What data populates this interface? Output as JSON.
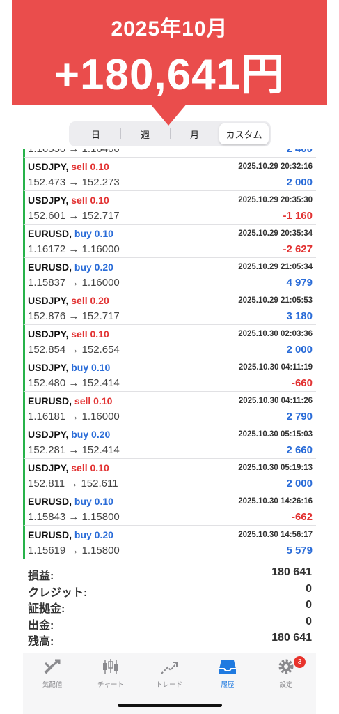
{
  "banner": {
    "month": "2025年10月",
    "amount": "+180,641円"
  },
  "segments": [
    "日",
    "週",
    "月",
    "カスタム"
  ],
  "selected_segment": "カスタム",
  "partial_row": {
    "prices": "1.16550 → 1.16400",
    "profit": "2 400"
  },
  "trades": [
    {
      "symbol": "USDJPY,",
      "direction": "sell",
      "volume": "sell 0.10",
      "time": "2025.10.29 20:32:16",
      "prices": "152.473 → 152.273",
      "profit": "2 000"
    },
    {
      "symbol": "USDJPY,",
      "direction": "sell",
      "volume": "sell 0.10",
      "time": "2025.10.29 20:35:30",
      "prices": "152.601 → 152.717",
      "profit": "-1 160"
    },
    {
      "symbol": "EURUSD,",
      "direction": "buy",
      "volume": "buy 0.10",
      "time": "2025.10.29 20:35:34",
      "prices": "1.16172 → 1.16000",
      "profit": "-2 627"
    },
    {
      "symbol": "EURUSD,",
      "direction": "buy",
      "volume": "buy 0.20",
      "time": "2025.10.29 21:05:34",
      "prices": "1.15837 → 1.16000",
      "profit": "4 979"
    },
    {
      "symbol": "USDJPY,",
      "direction": "sell",
      "volume": "sell 0.20",
      "time": "2025.10.29 21:05:53",
      "prices": "152.876 → 152.717",
      "profit": "3 180"
    },
    {
      "symbol": "USDJPY,",
      "direction": "sell",
      "volume": "sell 0.10",
      "time": "2025.10.30 02:03:36",
      "prices": "152.854 → 152.654",
      "profit": "2 000"
    },
    {
      "symbol": "USDJPY,",
      "direction": "buy",
      "volume": "buy 0.10",
      "time": "2025.10.30 04:11:19",
      "prices": "152.480 → 152.414",
      "profit": "-660"
    },
    {
      "symbol": "EURUSD,",
      "direction": "sell",
      "volume": "sell 0.10",
      "time": "2025.10.30 04:11:26",
      "prices": "1.16181 → 1.16000",
      "profit": "2 790"
    },
    {
      "symbol": "USDJPY,",
      "direction": "buy",
      "volume": "buy 0.20",
      "time": "2025.10.30 05:15:03",
      "prices": "152.281 → 152.414",
      "profit": "2 660"
    },
    {
      "symbol": "USDJPY,",
      "direction": "sell",
      "volume": "sell 0.10",
      "time": "2025.10.30 05:19:13",
      "prices": "152.811 → 152.611",
      "profit": "2 000"
    },
    {
      "symbol": "EURUSD,",
      "direction": "buy",
      "volume": "buy 0.10",
      "time": "2025.10.30 14:26:16",
      "prices": "1.15843 → 1.15800",
      "profit": "-662"
    },
    {
      "symbol": "EURUSD,",
      "direction": "buy",
      "volume": "buy 0.20",
      "time": "2025.10.30 14:56:17",
      "prices": "1.15619 → 1.15800",
      "profit": "5 579"
    }
  ],
  "summary": [
    {
      "label": "損益:",
      "value": "180 641"
    },
    {
      "label": "クレジット:",
      "value": "0"
    },
    {
      "label": "証拠金:",
      "value": "0"
    },
    {
      "label": "出金:",
      "value": "0"
    },
    {
      "label": "残高:",
      "value": "180 641"
    }
  ],
  "tabbar": {
    "items": [
      {
        "label": "気配値",
        "icon": "quotes-icon"
      },
      {
        "label": "チャート",
        "icon": "chart-icon"
      },
      {
        "label": "トレード",
        "icon": "trade-icon"
      },
      {
        "label": "履歴",
        "icon": "history-icon"
      },
      {
        "label": "設定",
        "icon": "settings-icon",
        "badge": "3"
      }
    ],
    "active": "履歴"
  },
  "colors": {
    "banner": "#ea4d4c",
    "buy": "#2a6cd8",
    "sell": "#e23232",
    "row_accent": "#27b24a",
    "active_tab": "#1f7ae0"
  }
}
